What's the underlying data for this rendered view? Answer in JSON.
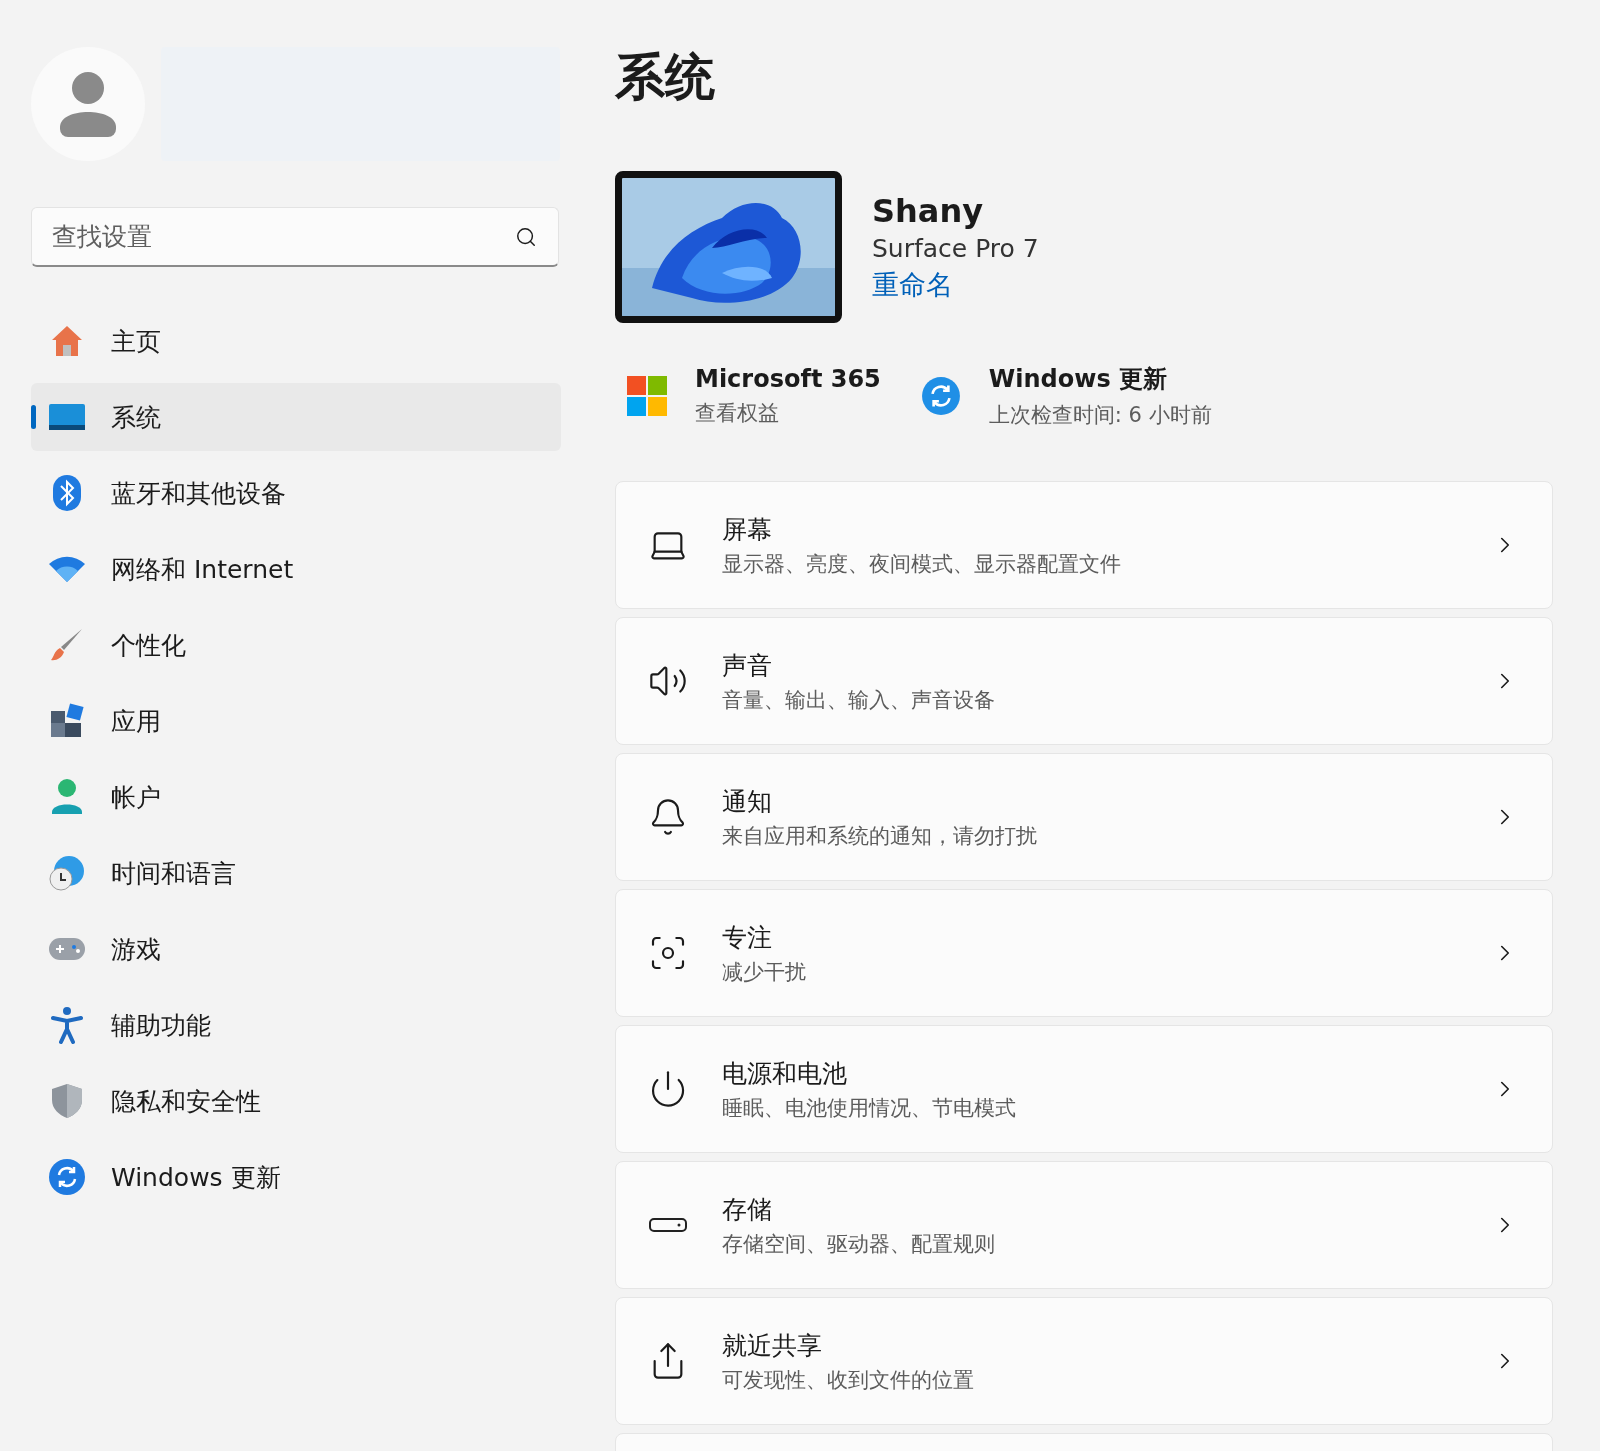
{
  "search": {
    "placeholder": "查找设置"
  },
  "nav": [
    {
      "label": "主页",
      "selected": false
    },
    {
      "label": "系统",
      "selected": true
    },
    {
      "label": "蓝牙和其他设备",
      "selected": false
    },
    {
      "label": "网络和 Internet",
      "selected": false
    },
    {
      "label": "个性化",
      "selected": false
    },
    {
      "label": "应用",
      "selected": false
    },
    {
      "label": "帐户",
      "selected": false
    },
    {
      "label": "时间和语言",
      "selected": false
    },
    {
      "label": "游戏",
      "selected": false
    },
    {
      "label": "辅助功能",
      "selected": false
    },
    {
      "label": "隐私和安全性",
      "selected": false
    },
    {
      "label": "Windows 更新",
      "selected": false
    }
  ],
  "page_title": "系统",
  "device": {
    "name": "Shany",
    "model": "Surface Pro 7",
    "rename_link": "重命名"
  },
  "quick_links": [
    {
      "title": "Microsoft 365",
      "subtitle": "查看权益"
    },
    {
      "title": "Windows 更新",
      "subtitle": "上次检查时间: 6 小时前"
    }
  ],
  "cards": [
    {
      "title": "屏幕",
      "subtitle": "显示器、亮度、夜间模式、显示器配置文件"
    },
    {
      "title": "声音",
      "subtitle": "音量、输出、输入、声音设备"
    },
    {
      "title": "通知",
      "subtitle": "来自应用和系统的通知，请勿打扰"
    },
    {
      "title": "专注",
      "subtitle": "减少干扰"
    },
    {
      "title": "电源和电池",
      "subtitle": "睡眠、电池使用情况、节电模式"
    },
    {
      "title": "存储",
      "subtitle": "存储空间、驱动器、配置规则"
    },
    {
      "title": "就近共享",
      "subtitle": "可发现性、收到文件的位置"
    }
  ]
}
